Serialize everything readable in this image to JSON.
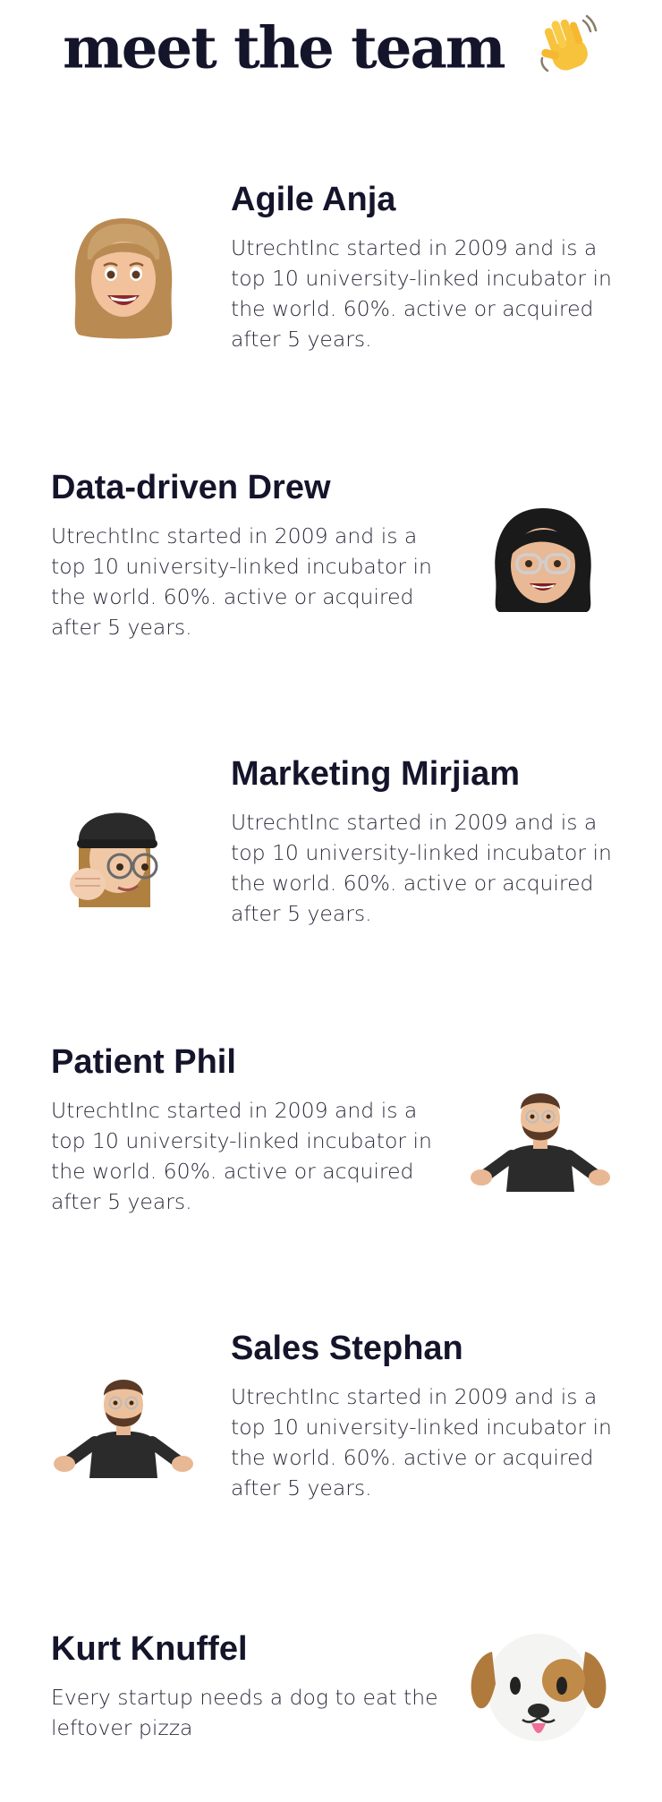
{
  "header": {
    "title": "meet the team",
    "emoji_icon": "waving-hand-icon"
  },
  "colors": {
    "heading": "#14142b",
    "body_text": "#2a2a3a",
    "background": "#ffffff"
  },
  "members": [
    {
      "name": "Agile Anja",
      "bio": "UtrechtInc started in 2009 and is a top 10 university-linked incubator in the world. 60%. active or acquired after 5 years.",
      "avatar_icon": "memoji-anja-icon"
    },
    {
      "name": "Data-driven Drew",
      "bio": "UtrechtInc started in 2009 and is a top 10 university-linked incubator in the world. 60%. active or acquired after 5 years.",
      "avatar_icon": "memoji-drew-icon"
    },
    {
      "name": "Marketing Mirjiam",
      "bio": "UtrechtInc started in 2009 and is a top 10 university-linked incubator in the world. 60%. active or acquired after 5 years.",
      "avatar_icon": "memoji-mirjiam-icon"
    },
    {
      "name": "Patient Phil",
      "bio": "UtrechtInc started in 2009 and is a top 10 university-linked incubator in the world. 60%. active or acquired after 5 years.",
      "avatar_icon": "memoji-phil-icon"
    },
    {
      "name": "Sales Stephan",
      "bio": "UtrechtInc started in 2009 and is a top 10 university-linked incubator in the world. 60%. active or acquired after 5 years.",
      "avatar_icon": "memoji-stephan-icon"
    },
    {
      "name": "Kurt Knuffel",
      "bio": "Every startup needs a dog to eat the leftover pizza",
      "avatar_icon": "dog-face-icon"
    }
  ]
}
